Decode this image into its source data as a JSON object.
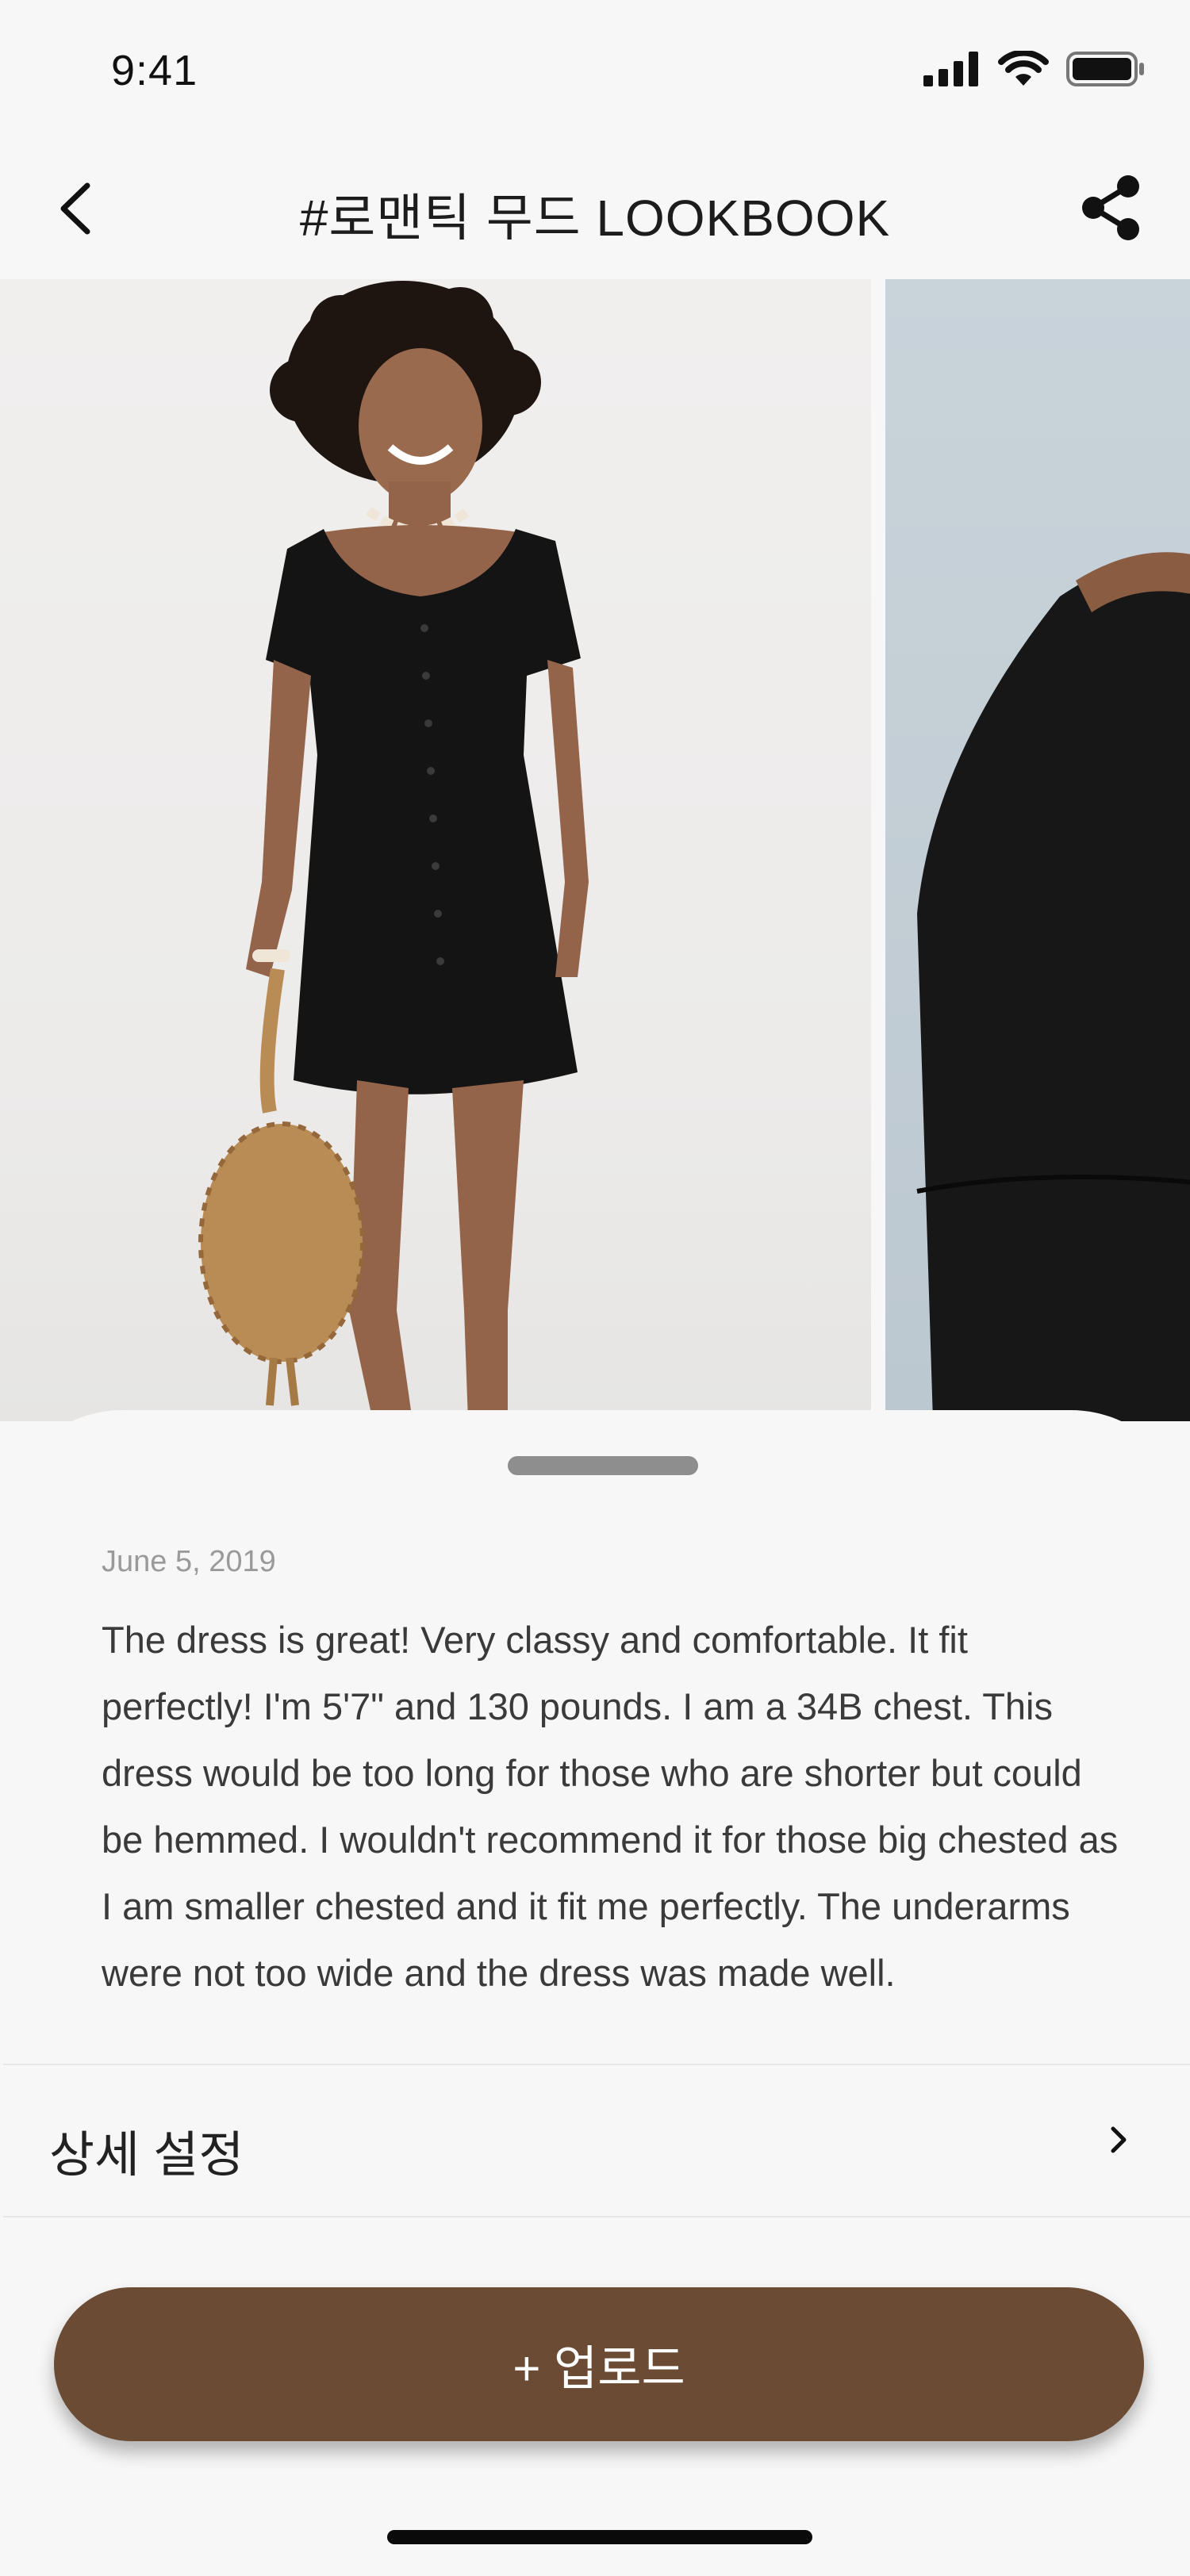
{
  "status_bar": {
    "time": "9:41",
    "icons": [
      "signal-icon",
      "wifi-icon",
      "battery-icon"
    ]
  },
  "nav": {
    "title": "#로맨틱 무드 LOOKBOOK",
    "back_icon": "chevron-left-icon",
    "share_icon": "share-icon"
  },
  "gallery": {
    "photos": [
      {
        "description_icon": "lookbook-photo-model-black-dress"
      },
      {
        "description_icon": "lookbook-photo-closeup-black-dress"
      }
    ]
  },
  "review": {
    "date": "June 5, 2019",
    "lines": [
      "The dress is great! Very classy and comfortable. It fit",
      "perfectly! I'm 5'7\" and 130 pounds. I am a 34B chest. This",
      "dress would be too long for those who are shorter but could",
      "be hemmed. I wouldn't recommend it for those big chested as",
      "I am smaller chested and it fit me perfectly. The underarms",
      "were not too wide and the dress was made well."
    ]
  },
  "settings": {
    "label": "상세 설정"
  },
  "upload": {
    "label": "+ 업로드"
  },
  "colors": {
    "background": "#f7f7f7",
    "accent": "#6b4b34",
    "text": "#222222",
    "muted": "#9a9a9a"
  }
}
